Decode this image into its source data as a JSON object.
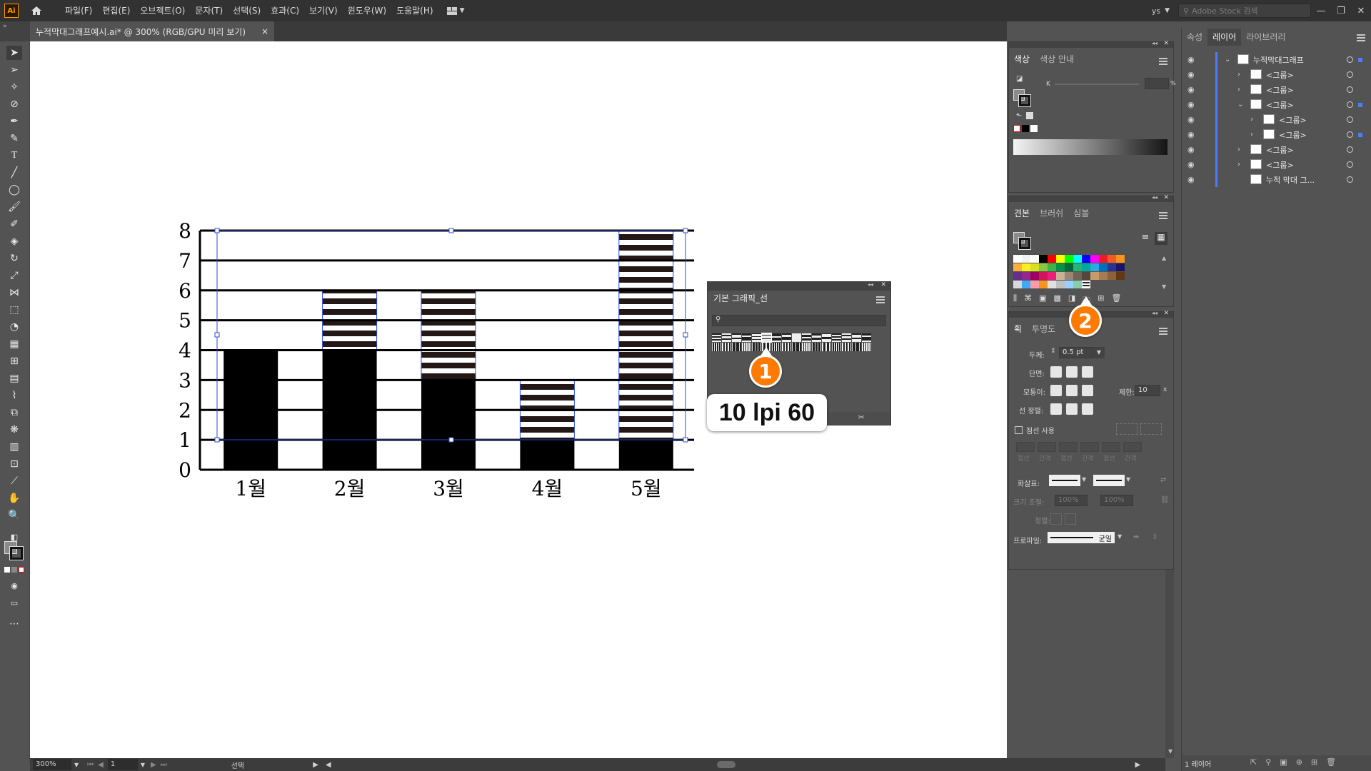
{
  "app": {
    "logo": "Ai",
    "menus": [
      "파일(F)",
      "편집(E)",
      "오브젝트(O)",
      "문자(T)",
      "선택(S)",
      "효과(C)",
      "보기(V)",
      "윈도우(W)",
      "도움말(H)"
    ],
    "user": "ys",
    "stock_placeholder": "Adobe Stock 검색"
  },
  "document": {
    "tab_title": "누적막대그래프예시.ai* @ 300% (RGB/GPU 미리 보기)",
    "close": "×"
  },
  "chart_data": {
    "type": "bar",
    "categories": [
      "1월",
      "2월",
      "3월",
      "4월",
      "5월"
    ],
    "y_tick_labels": [
      "0",
      "1",
      "2",
      "3",
      "4",
      "5",
      "6",
      "7",
      "8"
    ],
    "ylim": [
      0,
      8
    ],
    "series": [
      {
        "values": [
          4,
          4,
          3,
          1,
          1
        ],
        "fill": "solid black"
      },
      {
        "values": [
          0,
          2,
          3,
          2,
          7
        ],
        "fill": "horizontal line pattern"
      }
    ],
    "grid": true
  },
  "graphic_panel": {
    "title": "기본 그래픽_선"
  },
  "annotation": {
    "label": "10 lpi 60",
    "callout_1": "1",
    "callout_2": "2"
  },
  "color_panel": {
    "tabs": [
      "색상",
      "색상 안내"
    ],
    "channel": "K",
    "unit": "%"
  },
  "swatches_panel": {
    "tabs": [
      "견본",
      "브러쉬",
      "심볼"
    ]
  },
  "stroke_panel": {
    "tabs": [
      "획",
      "투명도"
    ],
    "weight_label": "두께:",
    "weight_value": "0.5 pt",
    "cap_label": "단면:",
    "corner_label": "모퉁이:",
    "limit_label": "제한:",
    "limit_value": "10",
    "align_label": "선 정렬:",
    "dashed_label": "점선 사용",
    "dash_labels": [
      "점선",
      "간격",
      "점선",
      "간격",
      "점선",
      "간격"
    ],
    "arrow_label": "화살표:",
    "scale_label": "크기 조절:",
    "scale_values": [
      "100%",
      "100%"
    ],
    "align2_label": "정렬:",
    "profile_label": "프로파일:",
    "profile_value": "균일"
  },
  "layers_panel": {
    "tabs": [
      "속성",
      "레이어",
      "라이브러리"
    ],
    "rows": [
      {
        "label": "누적막대그래프",
        "indent": 0
      },
      {
        "label": "<그룹>",
        "indent": 1
      },
      {
        "label": "<그룹>",
        "indent": 1
      },
      {
        "label": "<그룹>",
        "indent": 1
      },
      {
        "label": "<그룹>",
        "indent": 2
      },
      {
        "label": "<그룹>",
        "indent": 2
      },
      {
        "label": "<그룹>",
        "indent": 1
      },
      {
        "label": "<그룹>",
        "indent": 1
      },
      {
        "label": "누적 막대 그...",
        "indent": 1
      }
    ],
    "footer": "1 레이어"
  },
  "status": {
    "zoom": "300%",
    "page": "1",
    "mode": "선택"
  }
}
